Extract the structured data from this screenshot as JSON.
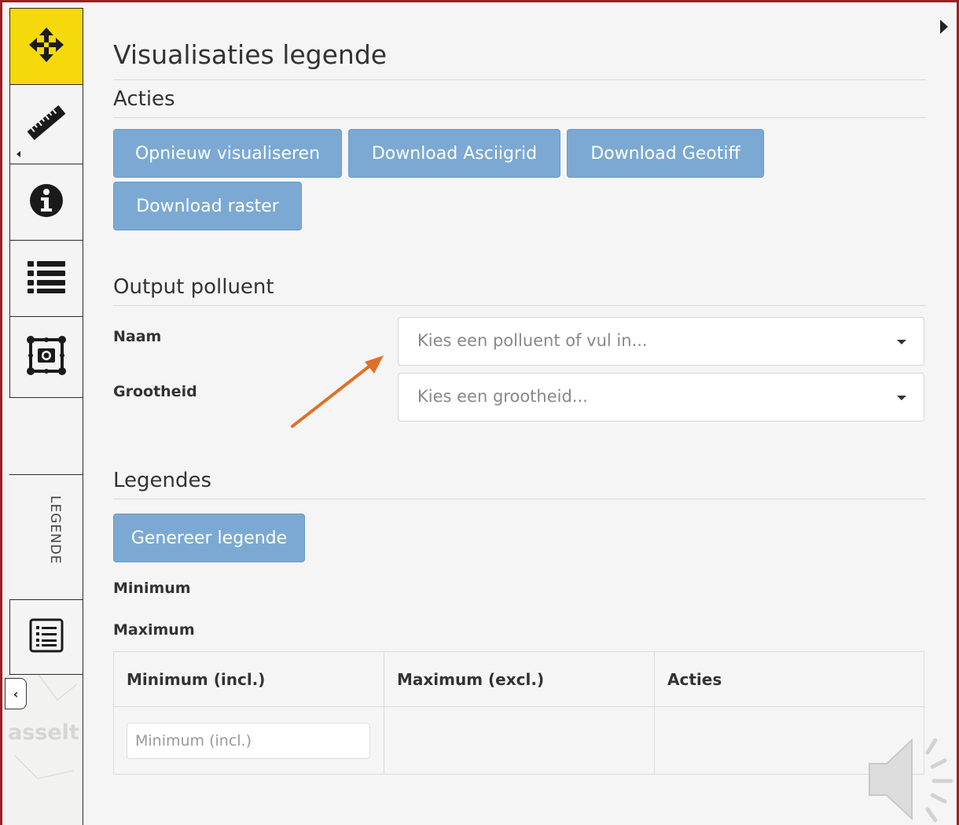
{
  "panel": {
    "title": "Visualisaties legende"
  },
  "sidebar": {
    "tools": [
      {
        "name": "move",
        "icon": "move-arrows-icon"
      },
      {
        "name": "measure",
        "icon": "ruler-icon"
      },
      {
        "name": "info",
        "icon": "info-circle-icon"
      },
      {
        "name": "layers",
        "icon": "list-icon"
      },
      {
        "name": "screenshot",
        "icon": "camera-frame-icon"
      }
    ],
    "legende_tab_label": "LEGENDE",
    "bottom_tool_icon": "list-document-icon"
  },
  "acties": {
    "heading": "Acties",
    "buttons": {
      "revisualize": "Opnieuw visualiseren",
      "download_ascii": "Download Asciigrid",
      "download_geotiff": "Download Geotiff",
      "download_raster": "Download raster"
    }
  },
  "output": {
    "heading": "Output polluent",
    "naam_label": "Naam",
    "naam_placeholder": "Kies een polluent of vul in...",
    "grootheid_label": "Grootheid",
    "grootheid_placeholder": "Kies een grootheid..."
  },
  "legendes": {
    "heading": "Legendes",
    "generate_button": "Genereer legende",
    "minimum_label": "Minimum",
    "maximum_label": "Maximum",
    "table": {
      "columns": [
        "Minimum (incl.)",
        "Maximum (excl.)",
        "Acties"
      ],
      "min_input_placeholder": "Minimum (incl.)"
    }
  },
  "map": {
    "city_label": "asselt"
  },
  "colors": {
    "accent_button": "#7ba9d3",
    "move_tool": "#f5d90a",
    "frame": "#9c1f24",
    "annotation_arrow": "#e07028"
  }
}
